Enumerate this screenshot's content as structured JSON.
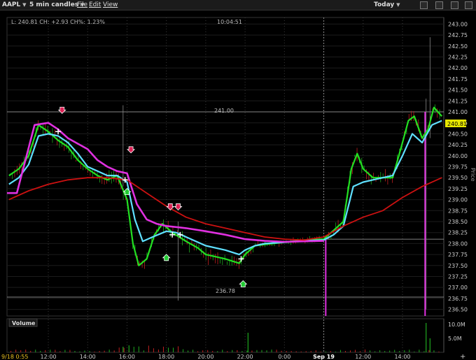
{
  "window": {
    "symbol": "AAPL",
    "interval": "5 min candles",
    "menus": [
      "File",
      "Edit",
      "View"
    ],
    "period": "Today"
  },
  "info": {
    "quote": "L: 240.81 CH: +2.93 CH%: 1.23%",
    "crosshair_time": "10:04:51"
  },
  "price_panel": {
    "axis_label": "Price",
    "last_price": "240.81",
    "hline_upper": "241.00",
    "hline_lower": "236.78"
  },
  "volume_panel": {
    "title": "Volume",
    "axis_ticks": [
      "10.0M",
      "5.0M"
    ]
  },
  "footer": {
    "start_stamp": "9/18 0:55",
    "add_symbol": "+"
  },
  "colors": {
    "background": "#000000",
    "green_line": "#22e022",
    "cyan_line": "#5fe0ff",
    "magenta_line": "#e030e0",
    "red_line": "#cc1111",
    "down_arrow": "#dd2255",
    "up_arrow": "#22cc33",
    "last_price_tag": "#e8e800"
  },
  "chart_data": {
    "type": "line",
    "y_ticks": [
      "243.00",
      "242.75",
      "242.50",
      "242.25",
      "242.00",
      "241.75",
      "241.50",
      "241.25",
      "241.00",
      "240.75",
      "240.50",
      "240.25",
      "240.00",
      "239.75",
      "239.50",
      "239.25",
      "239.00",
      "238.75",
      "238.50",
      "238.25",
      "238.00",
      "237.75",
      "237.50",
      "237.25",
      "237.00",
      "236.75",
      "236.50"
    ],
    "ylim": [
      236.35,
      243.15
    ],
    "x_ticks": [
      {
        "label": "12:00",
        "h": 12
      },
      {
        "label": "14:00",
        "h": 14
      },
      {
        "label": "16:00",
        "h": 16
      },
      {
        "label": "18:00",
        "h": 18
      },
      {
        "label": "20:00",
        "h": 20
      },
      {
        "label": "22:00",
        "h": 22
      },
      {
        "label": "0:00",
        "h": 24
      },
      {
        "label": "Sep 19",
        "h": 26
      },
      {
        "label": "12:00",
        "h": 28
      },
      {
        "label": "14:00",
        "h": 30
      }
    ],
    "xlim": [
      9.9,
      32.1
    ],
    "horizontal_lines": [
      241.0,
      236.78,
      238.1
    ],
    "series": [
      {
        "key": "green",
        "values": [
          [
            10,
            239.55
          ],
          [
            10.5,
            239.7
          ],
          [
            11,
            240.0
          ],
          [
            11.5,
            240.7
          ],
          [
            12,
            240.55
          ],
          [
            12.5,
            240.35
          ],
          [
            13,
            240.2
          ],
          [
            13.5,
            239.9
          ],
          [
            14,
            239.7
          ],
          [
            14.5,
            239.55
          ],
          [
            15,
            239.45
          ],
          [
            15.5,
            239.55
          ],
          [
            16,
            239.0
          ],
          [
            16.3,
            238.0
          ],
          [
            16.6,
            237.5
          ],
          [
            17,
            237.65
          ],
          [
            17.4,
            238.2
          ],
          [
            17.8,
            238.45
          ],
          [
            18.3,
            238.25
          ],
          [
            19,
            238.05
          ],
          [
            19.6,
            237.9
          ],
          [
            20,
            237.75
          ],
          [
            20.5,
            237.7
          ],
          [
            21,
            237.65
          ],
          [
            21.7,
            237.55
          ],
          [
            22,
            237.75
          ],
          [
            22.5,
            237.95
          ],
          [
            23,
            237.98
          ],
          [
            24,
            238.03
          ],
          [
            25,
            238.08
          ],
          [
            26,
            238.1
          ],
          [
            26.5,
            238.3
          ],
          [
            27,
            238.5
          ],
          [
            27.4,
            239.7
          ],
          [
            27.7,
            240.05
          ],
          [
            28,
            239.7
          ],
          [
            28.5,
            239.5
          ],
          [
            29,
            239.5
          ],
          [
            29.5,
            239.5
          ],
          [
            30,
            240.3
          ],
          [
            30.3,
            240.8
          ],
          [
            30.6,
            240.9
          ],
          [
            31,
            240.4
          ],
          [
            31.3,
            240.6
          ],
          [
            31.6,
            241.1
          ],
          [
            32,
            240.9
          ]
        ]
      },
      {
        "key": "cyan",
        "values": [
          [
            10,
            239.35
          ],
          [
            10.5,
            239.5
          ],
          [
            11,
            239.8
          ],
          [
            11.5,
            240.45
          ],
          [
            12,
            240.5
          ],
          [
            12.5,
            240.45
          ],
          [
            13,
            240.3
          ],
          [
            13.5,
            240.05
          ],
          [
            14,
            239.75
          ],
          [
            14.5,
            239.65
          ],
          [
            15,
            239.55
          ],
          [
            15.5,
            239.55
          ],
          [
            16,
            239.4
          ],
          [
            16.4,
            238.55
          ],
          [
            16.8,
            238.05
          ],
          [
            17.3,
            238.15
          ],
          [
            18,
            238.28
          ],
          [
            18.5,
            238.25
          ],
          [
            19,
            238.15
          ],
          [
            20,
            237.95
          ],
          [
            21,
            237.85
          ],
          [
            21.7,
            237.75
          ],
          [
            22,
            237.85
          ],
          [
            22.5,
            237.95
          ],
          [
            23,
            238.0
          ],
          [
            24,
            238.03
          ],
          [
            25,
            238.06
          ],
          [
            26,
            238.08
          ],
          [
            26.5,
            238.2
          ],
          [
            27,
            238.4
          ],
          [
            27.5,
            239.3
          ],
          [
            28,
            239.4
          ],
          [
            28.5,
            239.45
          ],
          [
            29,
            239.5
          ],
          [
            29.5,
            239.55
          ],
          [
            30,
            240.0
          ],
          [
            30.5,
            240.5
          ],
          [
            31,
            240.3
          ],
          [
            31.5,
            240.7
          ],
          [
            32,
            240.8
          ]
        ]
      },
      {
        "key": "magenta",
        "values": [
          [
            10,
            239.15
          ],
          [
            10.4,
            239.15
          ],
          [
            11.3,
            240.7
          ],
          [
            12,
            240.75
          ],
          [
            12.5,
            240.6
          ],
          [
            13,
            240.4
          ],
          [
            14,
            240.15
          ],
          [
            14.5,
            239.9
          ],
          [
            15,
            239.75
          ],
          [
            15.5,
            239.65
          ],
          [
            16,
            239.6
          ],
          [
            16.5,
            238.9
          ],
          [
            17,
            238.55
          ],
          [
            17.5,
            238.45
          ],
          [
            18,
            238.4
          ],
          [
            19,
            238.35
          ],
          [
            20,
            238.28
          ],
          [
            21,
            238.2
          ],
          [
            22,
            238.1
          ],
          [
            23,
            238.06
          ],
          [
            24,
            238.04
          ],
          [
            25,
            238.05
          ],
          [
            26,
            238.06
          ]
        ]
      },
      {
        "key": "red",
        "values": [
          [
            10,
            239.0
          ],
          [
            11,
            239.2
          ],
          [
            12,
            239.35
          ],
          [
            13,
            239.45
          ],
          [
            14,
            239.5
          ],
          [
            15,
            239.5
          ],
          [
            16,
            239.45
          ],
          [
            17,
            239.15
          ],
          [
            18,
            238.85
          ],
          [
            19,
            238.6
          ],
          [
            20,
            238.45
          ],
          [
            21,
            238.35
          ],
          [
            22,
            238.25
          ],
          [
            23,
            238.15
          ],
          [
            24,
            238.1
          ],
          [
            25,
            238.08
          ],
          [
            26,
            238.15
          ],
          [
            27,
            238.4
          ],
          [
            28,
            238.6
          ],
          [
            29,
            238.75
          ],
          [
            30,
            239.05
          ],
          [
            31,
            239.3
          ],
          [
            32,
            239.5
          ]
        ]
      }
    ],
    "signals_down": [
      [
        12.7,
        240.9
      ],
      [
        16.2,
        240.0
      ],
      [
        18.2,
        238.7
      ],
      [
        18.6,
        238.7
      ]
    ],
    "signals_up": [
      [
        16.0,
        239.35
      ],
      [
        18.0,
        237.85
      ],
      [
        21.9,
        237.25
      ]
    ]
  }
}
